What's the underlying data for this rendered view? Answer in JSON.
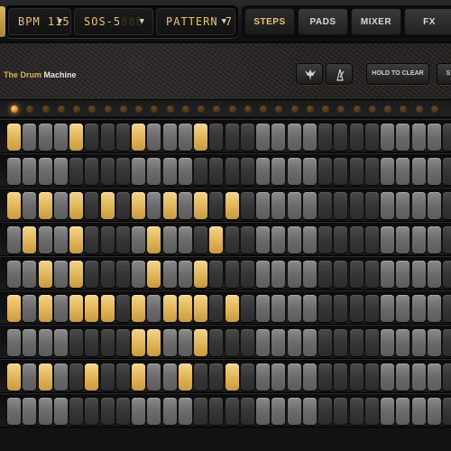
{
  "toolbar": {
    "bpm": {
      "text": "BPM 115",
      "ghost": ""
    },
    "kit": {
      "text": "SOS-5",
      "ghost": "888"
    },
    "pattern": {
      "text": "PATTERN 7",
      "ghost": ""
    },
    "tabs": [
      {
        "label": "STEPS",
        "active": true
      },
      {
        "label": "PADS",
        "active": false
      },
      {
        "label": "MIXER",
        "active": false
      },
      {
        "label": "FX",
        "active": false
      }
    ]
  },
  "header": {
    "title_prefix": "The Drum ",
    "title_suffix": "Machine",
    "hold_to_clear_label": "HOLD TO CLEAR",
    "edge_button_label": "S"
  },
  "indicator": {
    "count": 16,
    "active_step": 0
  },
  "sequencer": {
    "rows": [
      [
        1,
        0,
        0,
        0,
        1,
        0,
        0,
        0,
        1,
        0,
        0,
        0,
        1,
        0,
        0,
        0
      ],
      [
        0,
        0,
        0,
        0,
        0,
        0,
        0,
        0,
        0,
        0,
        0,
        0,
        0,
        0,
        0,
        0
      ],
      [
        1,
        0,
        1,
        0,
        1,
        0,
        1,
        0,
        1,
        0,
        1,
        0,
        1,
        0,
        1,
        0
      ],
      [
        0,
        1,
        0,
        0,
        1,
        0,
        0,
        0,
        0,
        1,
        0,
        0,
        0,
        1,
        0,
        0
      ],
      [
        0,
        0,
        1,
        0,
        1,
        0,
        0,
        0,
        0,
        1,
        0,
        0,
        1,
        0,
        0,
        0
      ],
      [
        1,
        0,
        1,
        0,
        1,
        1,
        1,
        0,
        1,
        0,
        1,
        1,
        1,
        0,
        1,
        0
      ],
      [
        0,
        0,
        0,
        0,
        0,
        0,
        0,
        0,
        1,
        1,
        0,
        0,
        1,
        0,
        0,
        0
      ],
      [
        1,
        0,
        1,
        0,
        0,
        1,
        0,
        0,
        1,
        0,
        0,
        1,
        0,
        0,
        1,
        0
      ],
      [
        0,
        0,
        0,
        0,
        0,
        0,
        0,
        0,
        0,
        0,
        0,
        0,
        0,
        0,
        0,
        0
      ]
    ]
  },
  "colors": {
    "accent_gold": "#e2b75a",
    "lcd_text": "#e8c46a",
    "led_on": "#f0a040"
  }
}
